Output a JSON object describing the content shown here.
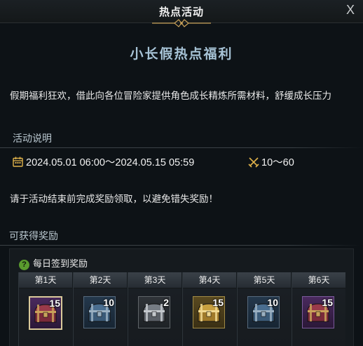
{
  "window": {
    "title": "热点活动",
    "close_label": "X"
  },
  "event": {
    "subtitle": "小长假热点福利",
    "description": "假期福利狂欢，借此向各位冒险家提供角色成长精炼所需材料，舒缓成长压力",
    "info_header": "活动说明",
    "time_range": "2024.05.01 06:00～2024.05.15 05:59",
    "level_range": "10～60",
    "notice": "请于活动结束前完成奖励领取，以避免错失奖励！"
  },
  "rewards": {
    "header": "可获得奖励",
    "panel_title": "每日签到奖励",
    "help_icon_label": "?",
    "days": [
      {
        "label": "第1天",
        "count": "15",
        "chest": "red-chest-icon",
        "rarity": "purple",
        "selected": true
      },
      {
        "label": "第2天",
        "count": "10",
        "chest": "blue-chest-icon",
        "rarity": "blue",
        "selected": false
      },
      {
        "label": "第3天",
        "count": "2",
        "chest": "silver-chest-icon",
        "rarity": "gray",
        "selected": false
      },
      {
        "label": "第4天",
        "count": "15",
        "chest": "gold-chest-icon",
        "rarity": "gold",
        "selected": false
      },
      {
        "label": "第5天",
        "count": "10",
        "chest": "blue-chest-icon",
        "rarity": "blue",
        "selected": false
      },
      {
        "label": "第6天",
        "count": "15",
        "chest": "red-chest-icon",
        "rarity": "purple",
        "selected": false
      }
    ]
  },
  "colors": {
    "subtitle": "#a7c3d6",
    "accent_gold": "#c9a25a",
    "help_green": "#5a9b2e"
  }
}
